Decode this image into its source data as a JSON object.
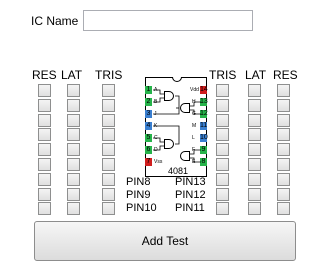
{
  "form": {
    "ic_name_label": "IC Name",
    "ic_name_value": ""
  },
  "columns": {
    "left": [
      "RES",
      "LAT",
      "TRIS"
    ],
    "right": [
      "TRIS",
      "LAT",
      "RES"
    ]
  },
  "chip": {
    "part_number": "4081",
    "left_pins": [
      {
        "num": "1",
        "label": "A",
        "color": "#26b34a"
      },
      {
        "num": "2",
        "label": "B",
        "color": "#26b34a"
      },
      {
        "num": "3",
        "label": "J",
        "color": "#3a7fd0"
      },
      {
        "num": "4",
        "label": "K",
        "color": "#3a7fd0"
      },
      {
        "num": "5",
        "label": "C",
        "color": "#26b34a"
      },
      {
        "num": "6",
        "label": "D",
        "color": "#26b34a"
      },
      {
        "num": "7",
        "label": "Vss",
        "color": "#d01e1e"
      }
    ],
    "right_pins": [
      {
        "num": "14",
        "label": "Vdd",
        "color": "#d01e1e"
      },
      {
        "num": "13",
        "label": "H",
        "color": "#26b34a"
      },
      {
        "num": "12",
        "label": "G",
        "color": "#26b34a"
      },
      {
        "num": "11",
        "label": "M",
        "color": "#3a7fd0"
      },
      {
        "num": "10",
        "label": "L",
        "color": "#3a7fd0"
      },
      {
        "num": "9",
        "label": "F",
        "color": "#26b34a"
      },
      {
        "num": "8",
        "label": "E",
        "color": "#26b34a"
      }
    ]
  },
  "pin_labels": {
    "left": [
      "PIN8",
      "PIN9",
      "PIN10"
    ],
    "right": [
      "PIN13",
      "PIN12",
      "PIN11"
    ]
  },
  "actions": {
    "add_test_label": "Add Test"
  }
}
